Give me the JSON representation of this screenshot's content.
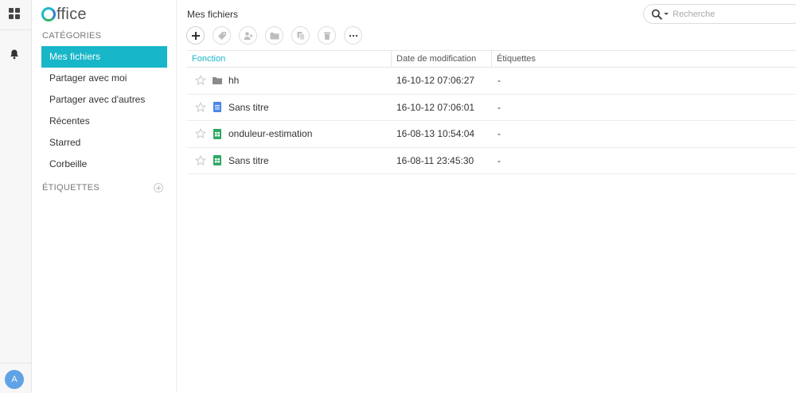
{
  "app": {
    "logo_text": "ffice"
  },
  "rail": {
    "avatar_initial": "A"
  },
  "sidebar": {
    "categories_title": "CATÉGORIES",
    "items": [
      {
        "label": "Mes fichiers",
        "active": true
      },
      {
        "label": "Partager avec moi"
      },
      {
        "label": "Partager avec d'autres"
      },
      {
        "label": "Récentes"
      },
      {
        "label": "Starred"
      },
      {
        "label": "Corbeille"
      }
    ],
    "tags_title": "ÉTIQUETTES"
  },
  "header": {
    "title": "Mes fichiers",
    "search_placeholder": "Recherche"
  },
  "table": {
    "columns": {
      "name": "Fonction",
      "date": "Date de modification",
      "tags": "Étiquettes"
    },
    "rows": [
      {
        "icon": "folder-icon",
        "name": "hh",
        "date": "16-10-12 07:06:27",
        "tags": "-"
      },
      {
        "icon": "document-icon",
        "name": "Sans titre",
        "date": "16-10-12 07:06:01",
        "tags": "-"
      },
      {
        "icon": "spreadsheet-icon",
        "name": "onduleur-estimation",
        "date": "16-08-13 10:54:04",
        "tags": "-"
      },
      {
        "icon": "spreadsheet-icon",
        "name": "Sans titre",
        "date": "16-08-11 23:45:30",
        "tags": "-"
      }
    ]
  },
  "colors": {
    "accent": "#17b6c8",
    "doc_blue": "#4a86e8",
    "sheet_green": "#2ea965",
    "folder_gray": "#8a8a8a"
  }
}
